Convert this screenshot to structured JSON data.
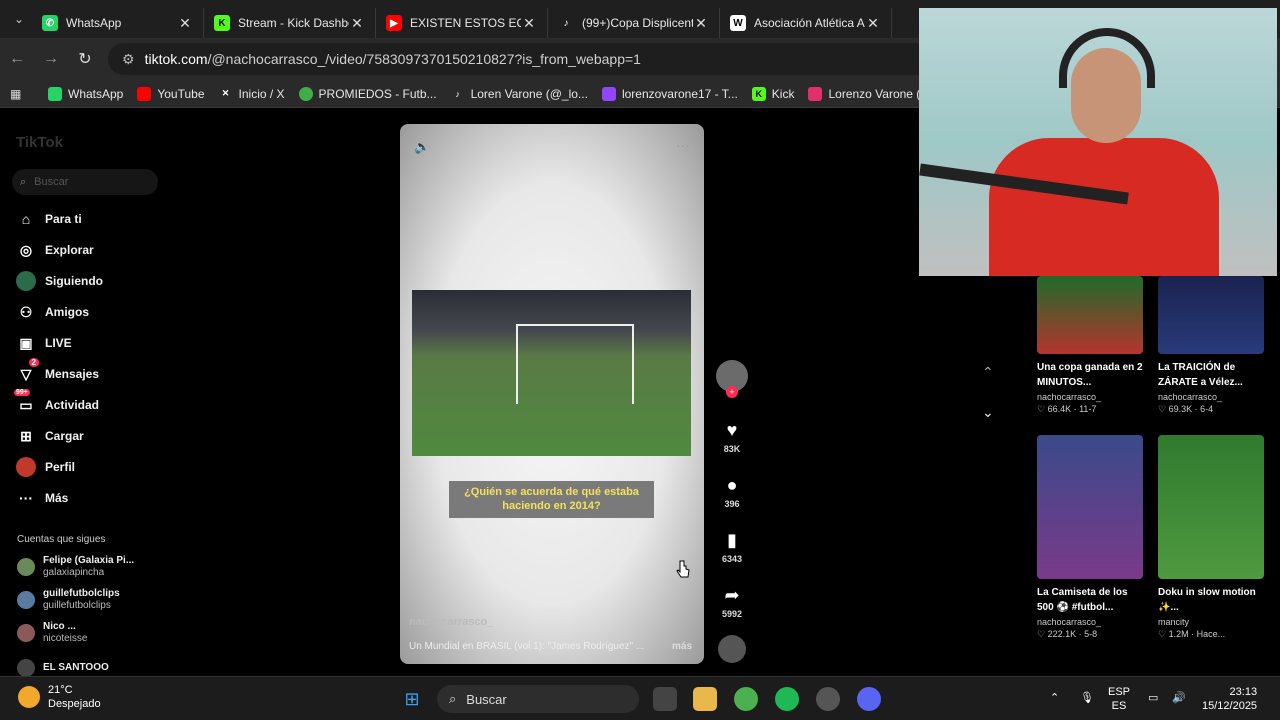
{
  "browser": {
    "tabs": [
      {
        "title": "WhatsApp",
        "icon": "whatsapp-icon",
        "color": "#25d366"
      },
      {
        "title": "Stream - Kick Dashbo",
        "icon": "kick-icon",
        "color": "#53fc18"
      },
      {
        "title": "EXISTEN ESTOS EQUI",
        "icon": "youtube-icon",
        "color": "#ff0000"
      },
      {
        "title": "(99+)Copa Displicent",
        "icon": "tiktok-icon",
        "color": "#ffffff"
      },
      {
        "title": "Asociación Atlética A",
        "icon": "wikipedia-icon",
        "color": "#ffffff"
      }
    ],
    "url_domain": "tiktok.com",
    "url_path": "/@nachocarrasco_/video/7583097370150210827?is_from_webapp=1",
    "bookmarks": [
      {
        "label": "WhatsApp",
        "color": "#25d366"
      },
      {
        "label": "YouTube",
        "color": "#ff0000"
      },
      {
        "label": "Inicio / X",
        "color": "#ffffff"
      },
      {
        "label": "PROMIEDOS - Futb...",
        "color": "#3fae49"
      },
      {
        "label": "Loren Varone (@_lo...",
        "color": "#ffffff"
      },
      {
        "label": "lorenzovarone17 - T...",
        "color": "#9146ff"
      },
      {
        "label": "Kick",
        "color": "#53fc18"
      },
      {
        "label": "Lorenzo Varone (Inst...",
        "color": "#e1306c"
      }
    ]
  },
  "sidebar": {
    "logo": "TikTok",
    "search_placeholder": "Buscar",
    "nav": [
      {
        "label": "Para ti",
        "icon": "home-icon"
      },
      {
        "label": "Explorar",
        "icon": "compass-icon"
      },
      {
        "label": "Siguiendo",
        "icon": "following-icon"
      },
      {
        "label": "Amigos",
        "icon": "friends-icon"
      },
      {
        "label": "LIVE",
        "icon": "live-icon"
      },
      {
        "label": "Mensajes",
        "icon": "messages-icon",
        "badge": "2"
      },
      {
        "label": "Actividad",
        "icon": "activity-icon",
        "badge": "99+"
      },
      {
        "label": "Cargar",
        "icon": "upload-icon"
      },
      {
        "label": "Perfil",
        "icon": "profile-icon"
      },
      {
        "label": "Más",
        "icon": "more-icon"
      }
    ],
    "following_title": "Cuentas que sigues",
    "following": [
      {
        "name": "Felipe (Galaxia Pi...",
        "user": "galaxiapincha"
      },
      {
        "name": "guillefutbolclips",
        "user": "guillefutbolclips"
      },
      {
        "name": "Nico ...",
        "user": "nicoteisse"
      },
      {
        "name": "EL SANTOOO",
        "user": ""
      }
    ]
  },
  "video": {
    "caption": "¿Quién se acuerda de qué estaba haciendo en 2014?",
    "username": "nachocarrasco_",
    "description": "Un Mundial en BRASIL (vol.1): \"James Rodríguez\" ...",
    "more": "más",
    "likes": "83K",
    "comments": "396",
    "saves": "6343",
    "shares": "5992"
  },
  "recommendations": [
    {
      "title": "Una copa ganada en 2 MINUTOS...",
      "user": "nachocarrasco_",
      "stats": "♡ 66.4K · 11-7",
      "color": "#b5342e"
    },
    {
      "title": "La TRAICIÓN de ZÁRATE a Vélez...",
      "user": "nachocarrasco_",
      "stats": "♡ 69.3K · 6-4",
      "color": "#2a3a7a"
    },
    {
      "title": "La Camiseta de los 500 ⚽ #futbol...",
      "user": "nachocarrasco_",
      "stats": "♡ 222.1K · 5-8",
      "color": "#7a3a8a"
    },
    {
      "title": "Doku in slow motion ✨...",
      "user": "mancity",
      "stats": "♡ 1.2M · Hace...",
      "color": "#3f8f3a"
    }
  ],
  "taskbar": {
    "temperature": "21°C",
    "weather": "Despejado",
    "search": "Buscar",
    "lang_top": "ESP",
    "lang_bottom": "ES",
    "time": "23:13",
    "date": "15/12/2025"
  }
}
